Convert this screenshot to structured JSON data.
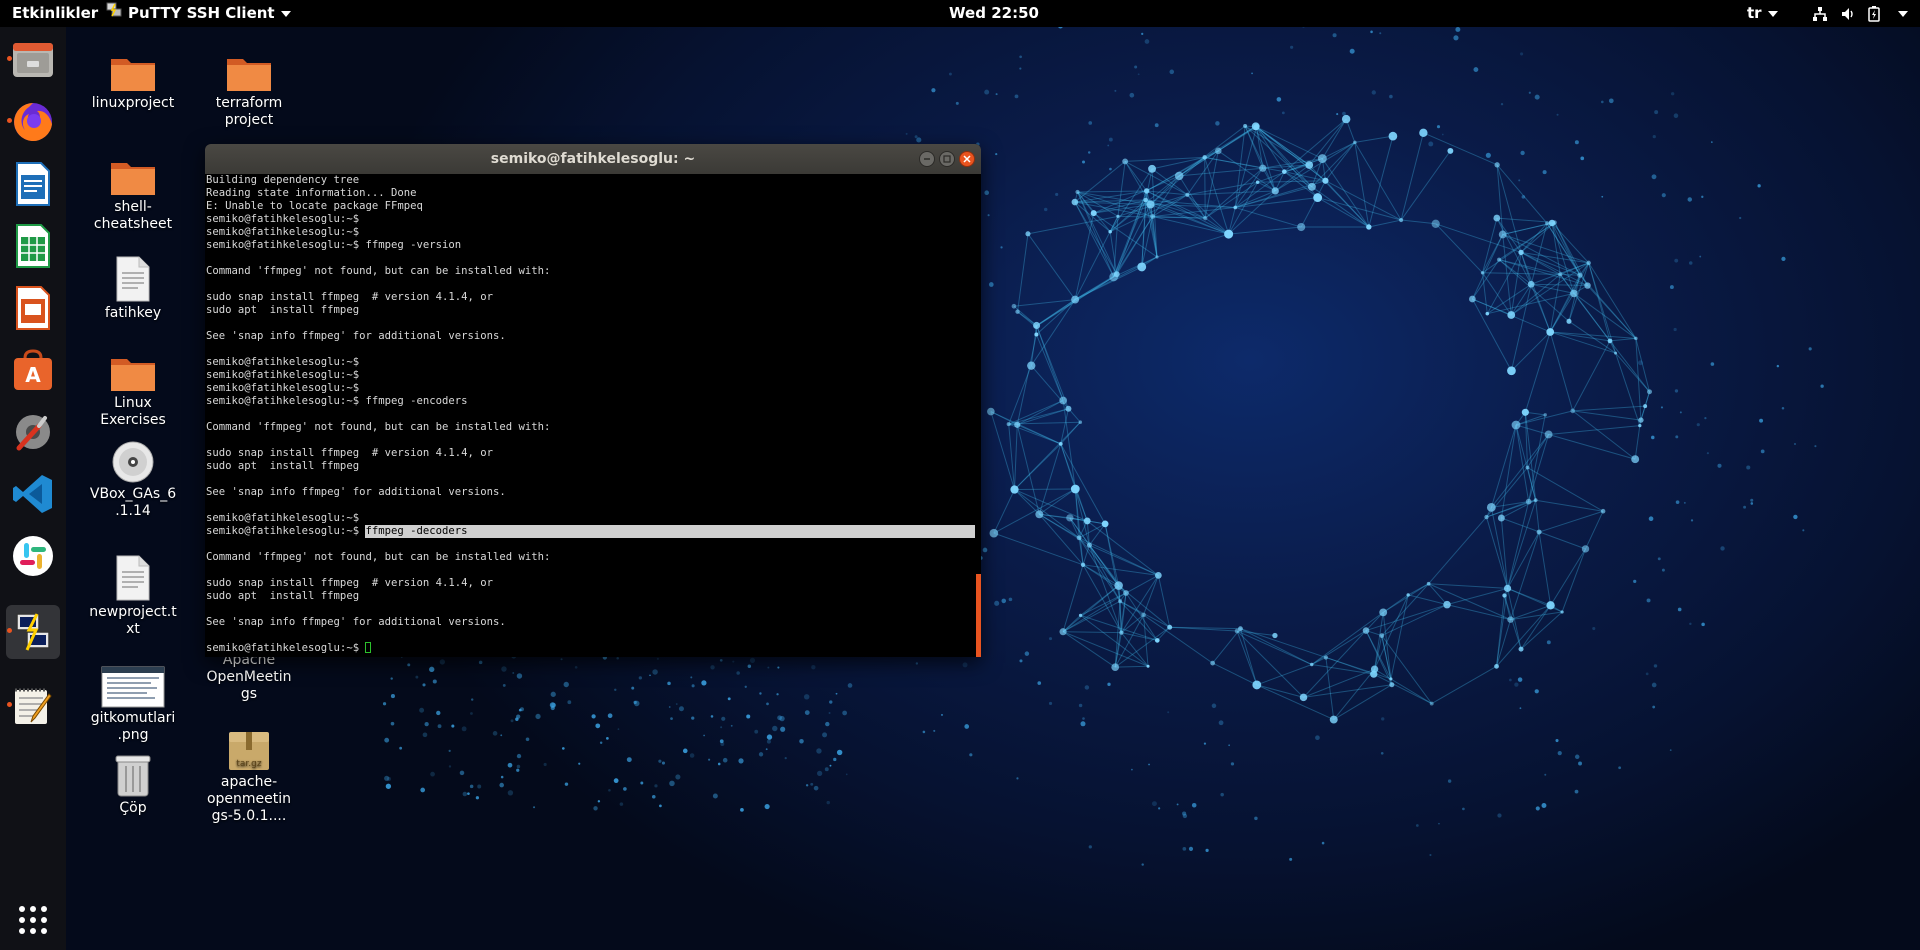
{
  "topbar": {
    "activities": "Etkinlikler",
    "app_name": "PuTTY SSH Client",
    "clock": "Wed 22:50",
    "language": "tr"
  },
  "dock": {
    "items": [
      {
        "name": "files",
        "icon": "files-icon"
      },
      {
        "name": "firefox",
        "icon": "firefox-icon"
      },
      {
        "name": "writer",
        "icon": "libreoffice-writer-icon"
      },
      {
        "name": "calc",
        "icon": "libreoffice-calc-icon"
      },
      {
        "name": "impress",
        "icon": "libreoffice-impress-icon"
      },
      {
        "name": "software",
        "icon": "ubuntu-software-icon"
      },
      {
        "name": "settings",
        "icon": "settings-icon"
      },
      {
        "name": "vscode",
        "icon": "vscode-icon"
      },
      {
        "name": "slack",
        "icon": "slack-icon"
      },
      {
        "name": "putty",
        "icon": "putty-icon"
      },
      {
        "name": "text-editor",
        "icon": "text-editor-icon"
      },
      {
        "name": "app-grid",
        "icon": "app-grid-icon"
      }
    ]
  },
  "desktop": {
    "icons": [
      {
        "label": "linuxproject",
        "type": "folder"
      },
      {
        "label": "terraform project",
        "type": "folder"
      },
      {
        "label": "shell-cheatsheet",
        "type": "folder"
      },
      {
        "label": "fatihkey",
        "type": "file"
      },
      {
        "label": "Linux Exercises",
        "type": "folder"
      },
      {
        "label": "VBox_GAs_6.1.14",
        "type": "disc"
      },
      {
        "label": "newproject.txt",
        "type": "file"
      },
      {
        "label": "Apache OpenMeetings",
        "type": "file"
      },
      {
        "label": "gitkomutlari.png",
        "type": "image"
      },
      {
        "label": "apache-openmeetings-5.0.1....",
        "type": "archive",
        "badge": "tar.gz"
      },
      {
        "label": "Çöp",
        "type": "trash"
      }
    ]
  },
  "terminal": {
    "title": "semiko@fatihkelesoglu: ~",
    "lines": [
      "Building dependency tree",
      "Reading state information... Done",
      "E: Unable to locate package FFmpeq",
      "semiko@fatihkelesoglu:~$",
      "semiko@fatihkelesoglu:~$",
      "semiko@fatihkelesoglu:~$ ffmpeg -version",
      "",
      "Command 'ffmpeg' not found, but can be installed with:",
      "",
      "sudo snap install ffmpeg  # version 4.1.4, or",
      "sudo apt  install ffmpeg",
      "",
      "See 'snap info ffmpeg' for additional versions.",
      "",
      "semiko@fatihkelesoglu:~$",
      "semiko@fatihkelesoglu:~$",
      "semiko@fatihkelesoglu:~$",
      "semiko@fatihkelesoglu:~$ ffmpeg -encoders",
      "",
      "Command 'ffmpeg' not found, but can be installed with:",
      "",
      "sudo snap install ffmpeg  # version 4.1.4, or",
      "sudo apt  install ffmpeg",
      "",
      "See 'snap info ffmpeg' for additional versions.",
      "",
      "semiko@fatihkelesoglu:~$"
    ],
    "selected_prompt": "semiko@fatihkelesoglu:~$ ",
    "selected_command": "ffmpeg -decoders",
    "lines_after": [
      "",
      "Command 'ffmpeg' not found, but can be installed with:",
      "",
      "sudo snap install ffmpeg  # version 4.1.4, or",
      "sudo apt  install ffmpeg",
      "",
      "See 'snap info ffmpeg' for additional versions.",
      ""
    ],
    "final_prompt": "semiko@fatihkelesoglu:~$ "
  },
  "colors": {
    "accent": "#e95420",
    "terminal_bg": "#000000",
    "topbar_bg": "#000000"
  }
}
